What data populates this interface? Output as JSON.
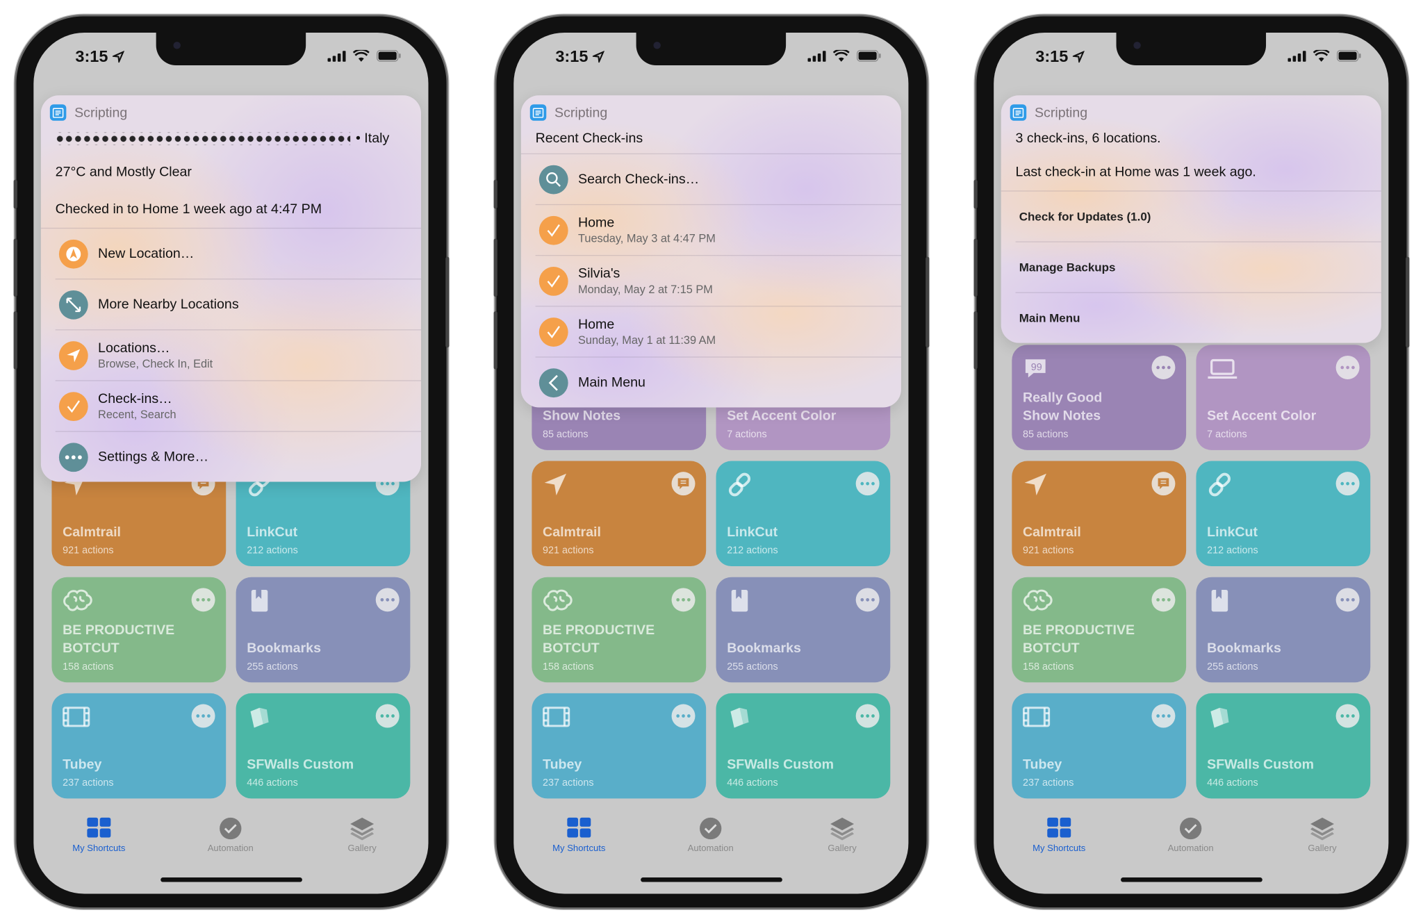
{
  "status_bar": {
    "time": "3:15"
  },
  "tab_bar": {
    "tabs": [
      {
        "label": "My Shortcuts",
        "icon": "grid-icon",
        "active": true
      },
      {
        "label": "Automation",
        "icon": "automation-check-icon",
        "active": false
      },
      {
        "label": "Gallery",
        "icon": "layers-icon",
        "active": false
      }
    ],
    "active_color": "#1a5fcf"
  },
  "shortcuts": [
    {
      "name": "Really Good\nShow Notes",
      "actions": "85 actions",
      "color": "#9a84b4",
      "icon": "quote-bubble-icon",
      "badge": "more"
    },
    {
      "name": "Set Accent Color",
      "actions": "7 actions",
      "color": "#b195c2",
      "icon": "laptop-icon",
      "badge": "more"
    },
    {
      "name": "Calmtrail",
      "actions": "921 actions",
      "color": "#c8843f",
      "icon": "location-arrow-icon",
      "badge": "comment"
    },
    {
      "name": "LinkCut",
      "actions": "212 actions",
      "color": "#4fb6c0",
      "icon": "link-icon",
      "badge": "more"
    },
    {
      "name": "BE PRODUCTIVE\nBOTCUT",
      "actions": "158 actions",
      "color": "#84b98a",
      "icon": "brain-icon",
      "badge": "more"
    },
    {
      "name": "Bookmarks",
      "actions": "255 actions",
      "color": "#8790b8",
      "icon": "book-icon",
      "badge": "more"
    },
    {
      "name": "Tubey",
      "actions": "237 actions",
      "color": "#59aec9",
      "icon": "film-icon",
      "badge": "more"
    },
    {
      "name": "SFWalls Custom",
      "actions": "446 actions",
      "color": "#4bb7a6",
      "icon": "wallpaper-icon",
      "badge": "more"
    }
  ],
  "phones": [
    {
      "widget": {
        "app": "Scripting",
        "rows": [
          {
            "type": "text",
            "text": "Italy",
            "redacted": true
          },
          {
            "type": "text",
            "text": "27°C and Mostly Clear"
          },
          {
            "type": "text",
            "text": "Checked in to Home 1 week ago at 4:47 PM"
          },
          {
            "type": "action",
            "icon": "location-a-icon",
            "color": "#f5a04a",
            "title": "New Location…"
          },
          {
            "type": "action",
            "icon": "expand-arrows-icon",
            "color": "#5f8f98",
            "title": "More Nearby Locations"
          },
          {
            "type": "action",
            "icon": "location-arrow-icon",
            "color": "#f5a04a",
            "title": "Locations…",
            "subtitle": "Browse, Check In, Edit"
          },
          {
            "type": "action",
            "icon": "checkmark-icon",
            "color": "#f5a04a",
            "title": "Check-ins…",
            "subtitle": "Recent, Search"
          },
          {
            "type": "action",
            "icon": "ellipsis-icon",
            "color": "#5f8f98",
            "title": "Settings & More…"
          }
        ]
      }
    },
    {
      "widget": {
        "app": "Scripting",
        "rows": [
          {
            "type": "text",
            "text": "Recent Check-ins"
          },
          {
            "type": "action",
            "icon": "search-icon",
            "color": "#5f8f98",
            "title": "Search Check-ins…"
          },
          {
            "type": "action",
            "icon": "checkmark-icon",
            "color": "#f5a04a",
            "title": "Home",
            "subtitle": "Tuesday, May 3 at 4:47 PM"
          },
          {
            "type": "action",
            "icon": "checkmark-icon",
            "color": "#f5a04a",
            "title": "Silvia's",
            "subtitle": "Monday, May 2 at 7:15 PM"
          },
          {
            "type": "action",
            "icon": "checkmark-icon",
            "color": "#f5a04a",
            "title": "Home",
            "subtitle": "Sunday, May 1 at 11:39 AM"
          },
          {
            "type": "action",
            "icon": "chevron-left-icon",
            "color": "#5f8f98",
            "title": "Main Menu"
          }
        ]
      }
    },
    {
      "widget": {
        "app": "Scripting",
        "rows": [
          {
            "type": "text",
            "text": "3 check-ins, 6 locations."
          },
          {
            "type": "text",
            "text": "Last check-in at Home was 1 week ago."
          },
          {
            "type": "small",
            "title": "Check for Updates (1.0)"
          },
          {
            "type": "small",
            "title": "Manage Backups"
          },
          {
            "type": "small",
            "title": "Main Menu"
          }
        ]
      }
    }
  ]
}
